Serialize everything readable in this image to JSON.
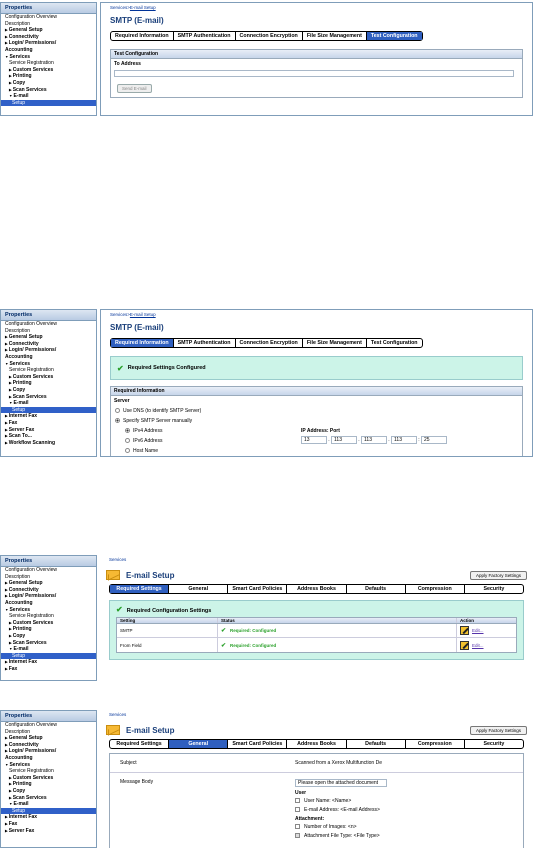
{
  "panel1": {
    "sidebar": {
      "header": "Properties",
      "items": [
        "Configuration Overview",
        "Description",
        "General Setup",
        "Connectivity",
        "Login/ Permissions/",
        "Accounting",
        "Services",
        "Service Registration",
        "Custom Services",
        "Printing",
        "Copy",
        "Scan Services",
        "E-mail",
        "Setup"
      ]
    },
    "breadcrumb": {
      "root": "Services>",
      "link": "E-mail Setup"
    },
    "title": "SMTP (E-mail)",
    "tabs": [
      "Required Information",
      "SMTP Authentication",
      "Connection Encryption",
      "File Size Management",
      "Test Configuration"
    ],
    "active_tab": 4,
    "section_title": "Test Configuration",
    "to_address_label": "To Address",
    "send_button": "Send E-mail"
  },
  "panel2": {
    "sidebar": {
      "header": "Properties",
      "items": [
        "Configuration Overview",
        "Description",
        "General Setup",
        "Connectivity",
        "Login/ Permissions/",
        "Accounting",
        "Services",
        "Service Registration",
        "Custom Services",
        "Printing",
        "Copy",
        "Scan Services",
        "E-mail",
        "Setup",
        "Internet Fax",
        "Fax",
        "Server Fax",
        "Scan To...",
        "Workflow Scanning"
      ]
    },
    "breadcrumb": {
      "root": "Services>",
      "link": "E-mail Setup"
    },
    "title": "SMTP (E-mail)",
    "tabs": [
      "Required Information",
      "SMTP Authentication",
      "Connection Encryption",
      "File Size Management",
      "Test Configuration"
    ],
    "active_tab": 0,
    "banner": "Required Settings Configured",
    "section_title": "Required Information",
    "server_label": "Server",
    "opt_dns": "Use DNS (to identify SMTP Server)",
    "opt_manual": "Specify SMTP Server manually",
    "ip_port_label": "IP Address: Port",
    "ipv4": "IPv4 Address",
    "ipv6": "IPv6 Address",
    "hostname": "Host Name",
    "ip": [
      "13",
      "113",
      "113",
      "113",
      "25"
    ]
  },
  "panel3": {
    "sidebar": {
      "header": "Properties",
      "items": [
        "Configuration Overview",
        "Description",
        "General Setup",
        "Connectivity",
        "Login/ Permissions/",
        "Accounting",
        "Services",
        "Service Registration",
        "Custom Services",
        "Printing",
        "Copy",
        "Scan Services",
        "E-mail",
        "Setup",
        "Internet Fax",
        "Fax"
      ]
    },
    "breadcrumb": "Services",
    "title": "E-mail Setup",
    "factory_button": "Apply Factory Settings",
    "tabs": [
      "Required Settings",
      "General",
      "Smart Card Policies",
      "Address Books",
      "Defaults",
      "Compression",
      "Security"
    ],
    "active_tab": 0,
    "banner": "Required Configuration Settings",
    "table_headers": [
      "Setting",
      "Status",
      "Action"
    ],
    "rows": [
      {
        "setting": "SMTP",
        "status": "Required: Configured",
        "action": "Edit..."
      },
      {
        "setting": "From Field",
        "status": "Required: Configured",
        "action": "Edit..."
      }
    ]
  },
  "panel4": {
    "sidebar": {
      "header": "Properties",
      "items": [
        "Configuration Overview",
        "Description",
        "General Setup",
        "Connectivity",
        "Login/ Permissions/",
        "Accounting",
        "Services",
        "Service Registration",
        "Custom Services",
        "Printing",
        "Copy",
        "Scan Services",
        "E-mail",
        "Setup",
        "Internet Fax",
        "Fax",
        "Server Fax"
      ]
    },
    "breadcrumb": "Services",
    "title": "E-mail Setup",
    "factory_button": "Apply Factory Settings",
    "tabs": [
      "Required Settings",
      "General",
      "Smart Card Policies",
      "Address Books",
      "Defaults",
      "Compression",
      "Security"
    ],
    "active_tab": 1,
    "subject_label": "Subject",
    "subject_value": "Scanned from a Xerox Multifunction De",
    "message_label": "Message Body",
    "message_value": "Please open the attached document",
    "user_heading": "User",
    "user_name": "User Name: <Name>",
    "user_email": "E-mail Address: <E-mail Address>",
    "attachment_heading": "Attachment:",
    "num_images": "Number of Images: <n>",
    "file_type": "Attachment File Type: <File Type>"
  }
}
